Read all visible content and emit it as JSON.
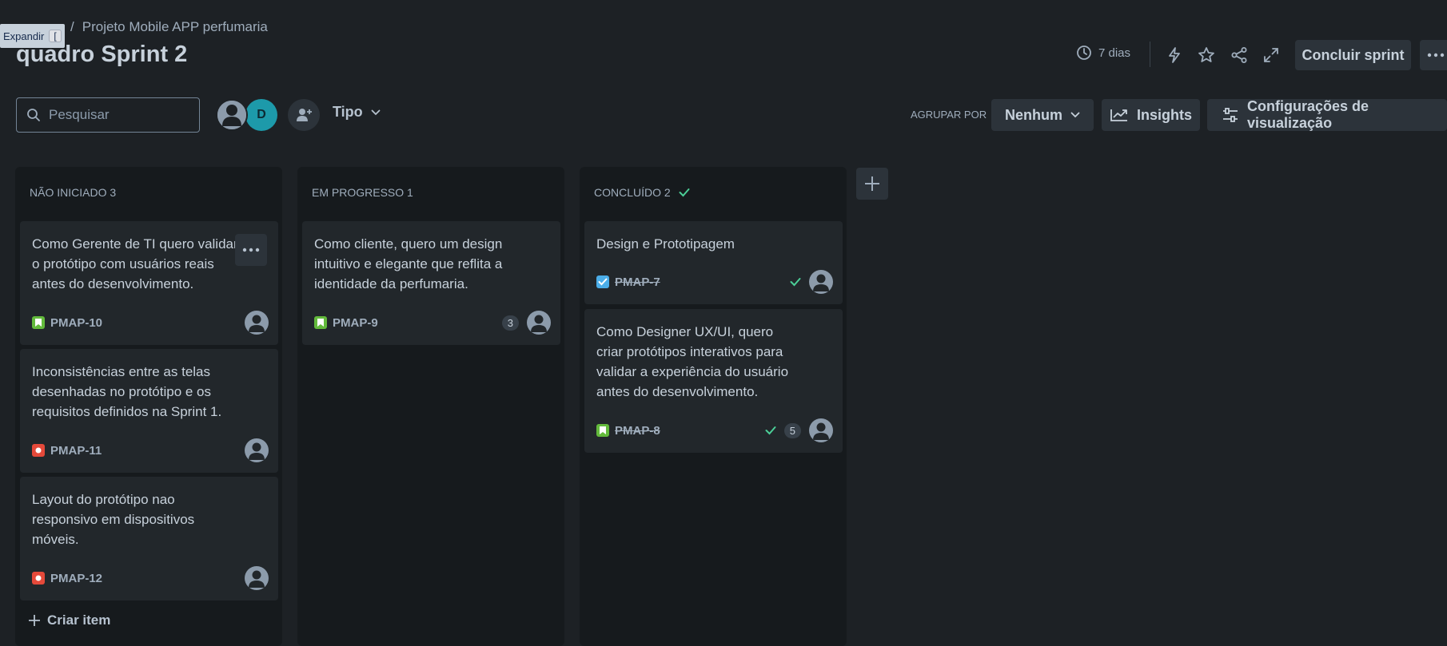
{
  "header": {
    "expand_tooltip": "Expandir",
    "expand_shortcut": "[",
    "breadcrumb_sep": "/",
    "breadcrumb_project": "Projeto Mobile APP perfumaria",
    "title": "quadro Sprint 2",
    "days_remaining": "7 dias",
    "complete_sprint": "Concluir sprint"
  },
  "toolbar": {
    "search_placeholder": "Pesquisar",
    "avatar_d_initial": "D",
    "filter_type": "Tipo",
    "group_by_label": "AGRUPAR POR",
    "group_by_value": "Nenhum",
    "insights": "Insights",
    "view_settings": "Configurações de visualização"
  },
  "columns": [
    {
      "title": "NÃO INICIADO 3",
      "cards": [
        {
          "text": "Como Gerente de TI quero validar o protótipo com usuários reais antes do desenvolvimento.",
          "key": "PMAP-10",
          "type": "story"
        },
        {
          "text": "Inconsistências entre as telas desenhadas no protótipo e os requisitos definidos na Sprint 1.",
          "key": "PMAP-11",
          "type": "bug"
        },
        {
          "text": "Layout do protótipo nao responsivo em dispositivos móveis.",
          "key": "PMAP-12",
          "type": "bug"
        }
      ],
      "create_label": "Criar item"
    },
    {
      "title": "EM PROGRESSO 1",
      "cards": [
        {
          "text": "Como cliente, quero um design intuitivo e elegante que reflita a identidade da perfumaria.",
          "key": "PMAP-9",
          "type": "story",
          "estimate": "3"
        }
      ]
    },
    {
      "title": "CONCLUÍDO 2",
      "cards": [
        {
          "text": "Design e Prototipagem",
          "key": "PMAP-7",
          "type": "task",
          "done": true
        },
        {
          "text": "Como Designer UX/UI, quero criar protótipos interativos para validar a experiência do usuário antes do desenvolvimento.",
          "key": "PMAP-8",
          "type": "story",
          "done": true,
          "estimate": "5"
        }
      ]
    }
  ],
  "colors": {
    "background": "#1d2125",
    "column": "#161a1d",
    "card": "#22272b",
    "story": "#63ba3c",
    "bug": "#e5493a",
    "task": "#4bade8",
    "done_check": "#4bce97",
    "accent_avatar": "#1d9aaa"
  }
}
